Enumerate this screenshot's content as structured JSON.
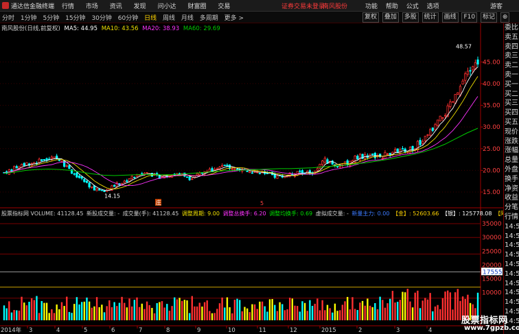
{
  "menubar": {
    "app_title": "通达信金融终端",
    "menus": [
      "行情",
      "市场",
      "资讯",
      "发现",
      "问小达",
      "财富圈",
      "交易"
    ],
    "warning": "证券交易未登录",
    "stock_name": "南风股份",
    "right_menus": [
      "功能",
      "帮助",
      "公式",
      "选项"
    ],
    "guest": "游客"
  },
  "periodbar": {
    "periods": [
      "分时",
      "1分钟",
      "5分钟",
      "15分钟",
      "30分钟",
      "60分钟",
      "日线",
      "周线",
      "月线",
      "多周期",
      "更多 >"
    ],
    "active_period": "日线",
    "tools": [
      "复权",
      "叠加",
      "多股",
      "统计",
      "画线",
      "F10",
      "标记",
      "⊕"
    ]
  },
  "price_legend": {
    "title": "南风股份(日线,前复权)",
    "ma5": "MA5: 44.95",
    "ma10": "MA10: 43.56",
    "ma20": "MA20: 38.93",
    "ma60": "MA60: 29.69"
  },
  "volume_legend": {
    "prefix": "股票指标网 VOLUME: 41128.45",
    "new_vol": "新股成交量: -",
    "volume_hand": "成交量(手): 41128.45",
    "adjust_period": "调整周期: 9.00",
    "adjust_turnover": "调整总换手: 6.20",
    "avg_turnover": "调整均换手: 0.69",
    "virtual_vol": "虚拟成交量: -",
    "shares_main": "新量主力: 0.00",
    "gold": "【金】: 52603.66",
    "silver": "【银】: 125778.08",
    "tail": "【阿】"
  },
  "price_axis": [
    "45.00",
    "40.00",
    "35.00",
    "30.00",
    "25.00",
    "20.00",
    "15.00"
  ],
  "volume_axis": [
    "35000",
    "30000",
    "25000",
    "20000",
    "15000",
    "10000"
  ],
  "volume_marker": "17555",
  "price_annotations": {
    "high": "48.57",
    "low": "14.15",
    "event_a": "庄",
    "event_b": "5"
  },
  "date_axis": {
    "year_label": "2014年",
    "months": [
      "3",
      "4",
      "5",
      "6",
      "7",
      "8",
      "9",
      "10",
      "11",
      "12",
      "2015",
      "2",
      "3",
      "4"
    ]
  },
  "right_panel": [
    "委比",
    "卖五",
    "卖四",
    "卖三",
    "卖二",
    "卖一",
    "买一",
    "买二",
    "买三",
    "买四",
    "买五",
    "现价",
    "涨跌",
    "涨幅",
    "总量",
    "外盘",
    "换手",
    "净资",
    "收益",
    "分笔",
    "行情",
    "14:5",
    "14:5",
    "14:5",
    "14:5",
    "14:5",
    "14:5",
    "14:5",
    "14:5",
    "14:5",
    "14:5",
    "14:5"
  ],
  "watermark": {
    "title": "股票指标网",
    "url": "www.7gpzb.com"
  },
  "colors": {
    "ma5": "#ffffff",
    "ma10": "#f0e000",
    "ma20": "#ff33ff",
    "ma60": "#00cc00",
    "up": "#ff3030",
    "down": "#00ffff",
    "axis": "#a00000"
  },
  "chart_data": {
    "type": "candlestick",
    "y_range": [
      12,
      52
    ],
    "volume_range": [
      0,
      38000
    ],
    "ma60_path": [
      19.3,
      19.6,
      20.0,
      20.2,
      20.3,
      20.2,
      20.0,
      19.6,
      19.2,
      18.9,
      18.8,
      18.9,
      19.0,
      19.1,
      19.0,
      19.0,
      19.1,
      19.3,
      19.5,
      19.7,
      19.9,
      20.0,
      20.1,
      20.2,
      20.3,
      20.4,
      20.4,
      20.5,
      20.6,
      20.8,
      21.0,
      21.2,
      21.5,
      21.8,
      22.2,
      22.6,
      23.1,
      23.6,
      24.2,
      25.0,
      26.0,
      27.3,
      28.6,
      29.7
    ],
    "close_path": [
      19.5,
      20.5,
      21.5,
      22.0,
      23.0,
      22.5,
      20.0,
      18.0,
      16.0,
      15.0,
      16.5,
      17.5,
      19.0,
      19.5,
      18.5,
      19.0,
      19.5,
      18.0,
      19.5,
      20.5,
      21.0,
      20.5,
      20.0,
      19.5,
      19.0,
      18.5,
      19.0,
      19.5,
      19.5,
      22.5,
      21.0,
      21.5,
      23.0,
      23.5,
      23.0,
      24.0,
      24.5,
      25.0,
      27.0,
      30.0,
      33.0,
      37.0,
      42.0,
      45.0
    ]
  }
}
